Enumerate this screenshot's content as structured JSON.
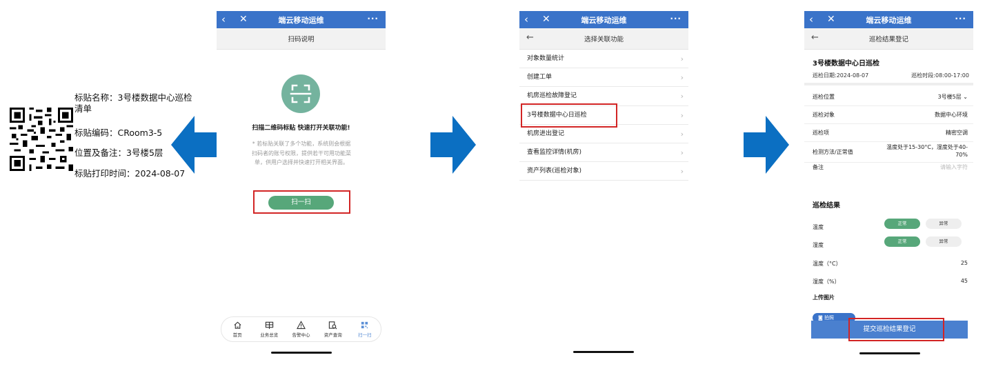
{
  "label": {
    "name": "标贴名称：3号楼数据中心巡检清单",
    "code": "标贴编码：CRoom3-5",
    "location": "位置及备注：3号楼5层",
    "print_time": "标贴打印时间：2024-08-07"
  },
  "app": {
    "title": "端云移动运维",
    "back": "‹",
    "close": "✕",
    "more": "···"
  },
  "screen1": {
    "subtitle": "扫码说明",
    "headline": "扫描二维码标贴 快速打开关联功能!",
    "description": "* 若标贴关联了多个功能，系统则会根据扫码者的账号权限，提供若干可用功能菜单，供用户选择并快速打开相关界面。",
    "scan_button": "扫一扫",
    "tabs": [
      {
        "label": "首页",
        "icon": "home-icon"
      },
      {
        "label": "业务总览",
        "icon": "grid-overview-icon"
      },
      {
        "label": "告警中心",
        "icon": "warning-icon"
      },
      {
        "label": "资产查询",
        "icon": "asset-search-icon"
      },
      {
        "label": "扫一扫",
        "icon": "qr-scan-icon",
        "active": true
      }
    ]
  },
  "screen2": {
    "subtitle": "选择关联功能",
    "items": [
      "对象数量统计",
      "创建工单",
      "机房巡检故障登记",
      "3号楼数据中心日巡检",
      "机房进出登记",
      "查看监控详情(机房)",
      "资产列表(巡检对象)"
    ],
    "highlighted_index": 3
  },
  "screen3": {
    "subtitle": "巡检结果登记",
    "title": "3号楼数据中心日巡检",
    "date": "巡检日期:2024-08-07",
    "period": "巡检时段:08:00-17:00",
    "fields": [
      {
        "label": "巡检位置",
        "value": "3号楼5层 ⌄"
      },
      {
        "label": "巡检对象",
        "value": "数据中心环境"
      },
      {
        "label": "巡检项",
        "value": "精密空调"
      },
      {
        "label": "检测方法/正常值",
        "value": "温度处于15-30°C，湿度处于40-70%"
      },
      {
        "label": "备注",
        "value": "请输入字符"
      }
    ],
    "results_title": "巡检结果",
    "results": [
      {
        "label": "温度",
        "ok": "正常",
        "bad": "异常"
      },
      {
        "label": "湿度",
        "ok": "正常",
        "bad": "异常"
      }
    ],
    "temp_label": "温度（°C）",
    "temp_value": "25",
    "humidity_label": "湿度（%）",
    "humidity_value": "45",
    "upload_label": "上传图片",
    "photo_button": "拍照",
    "submit_button": "提交巡检结果登记"
  },
  "colors": {
    "header_blue": "#3a73c9",
    "arrow_blue": "#0b6fc2",
    "ok_green": "#57a77a",
    "highlight_red": "#d22424"
  }
}
